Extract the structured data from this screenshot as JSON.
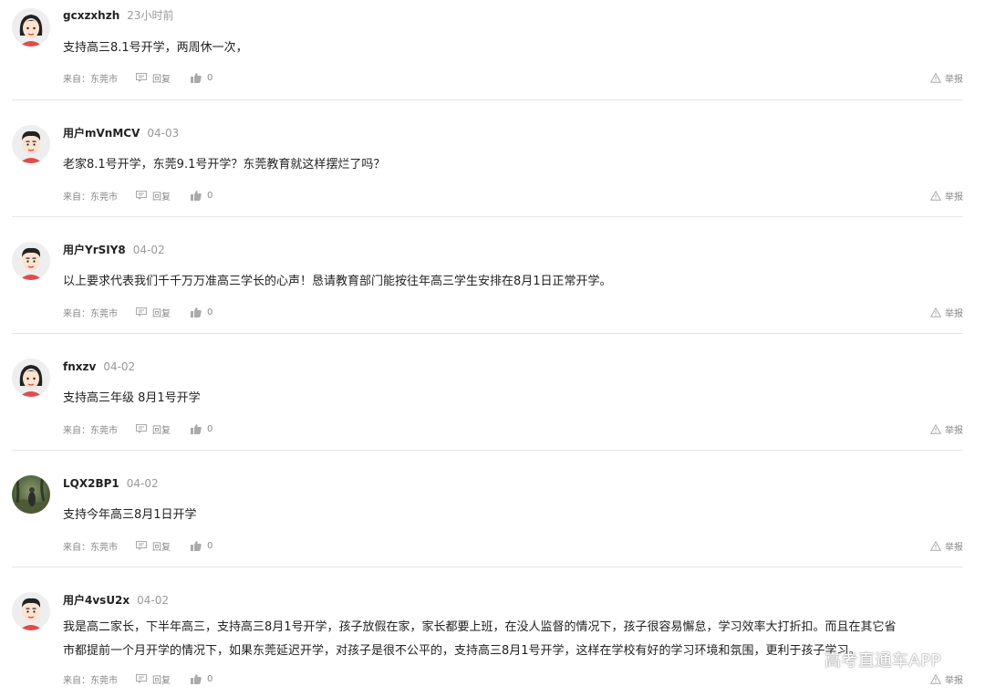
{
  "comments": [
    {
      "user": "gcxzxhzh",
      "time": "23小时前",
      "avatar": "female-avatar-icon",
      "lines": [
        "支持高三8.1号开学，两周休一次，"
      ],
      "from": "来自：东莞市",
      "reply": "回复",
      "likes": "0",
      "report": "举报"
    },
    {
      "user": "用户mVnMCV",
      "time": "04-03",
      "avatar": "male-avatar-icon",
      "lines": [
        "老家8.1号开学，东莞9.1号开学？东莞教育就这样摆烂了吗？"
      ],
      "from": "来自：东莞市",
      "reply": "回复",
      "likes": "0",
      "report": "举报"
    },
    {
      "user": "用户YrSIY8",
      "time": "04-02",
      "avatar": "male-avatar-icon",
      "lines": [
        "以上要求代表我们千千万万准高三学长的心声！恳请教育部门能按往年高三学生安排在8月1日正常开学。"
      ],
      "from": "来自：东莞市",
      "reply": "回复",
      "likes": "0",
      "report": "举报"
    },
    {
      "user": "fnxzv",
      "time": "04-02",
      "avatar": "female-avatar-icon",
      "lines": [
        "支持高三年级 8月1号开学"
      ],
      "from": "来自：东莞市",
      "reply": "回复",
      "likes": "0",
      "report": "举报"
    },
    {
      "user": "LQX2BP1",
      "time": "04-02",
      "avatar": "photo-avatar-icon",
      "lines": [
        "支持今年高三8月1日开学"
      ],
      "from": "来自：东莞市",
      "reply": "回复",
      "likes": "0",
      "report": "举报"
    },
    {
      "user": "用户4vsU2x",
      "time": "04-02",
      "avatar": "male-avatar-icon",
      "lines": [
        "我是高二家长，下半年高三，支持高三8月1号开学，孩子放假在家，家长都要上班，在没人监督的情况下，孩子很容易懈怠，学习效率大打折扣。而且在其它省",
        "市都提前一个月开学的情况下，如果东莞延迟开学，对孩子是很不公平的，支持高三8月1号开学，这样在学校有好的学习环境和氛围，更利于孩子学习。"
      ],
      "from": "来自：东莞市",
      "reply": "回复",
      "likes": "0",
      "report": "举报"
    }
  ],
  "watermark": "高考直通车APP"
}
